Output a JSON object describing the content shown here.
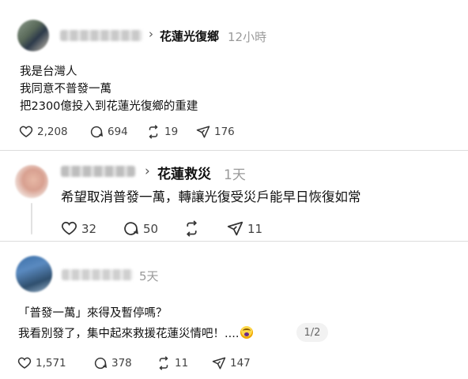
{
  "posts": [
    {
      "group": "花蓮光復鄉",
      "time": "12小時",
      "lines": [
        "我是台灣人",
        "我同意不普發一萬",
        "把2300億投入到花蓮光復鄉的重建"
      ],
      "likes": "2,208",
      "comments": "694",
      "reposts": "19",
      "shares": "176"
    },
    {
      "group": "花蓮救災",
      "time": "1天",
      "lines": [
        "希望取消普發一萬，轉讓光復受災戶能早日恢復如常"
      ],
      "likes": "32",
      "comments": "50",
      "reposts": "",
      "shares": "11"
    },
    {
      "group": "",
      "time": "5天",
      "lines": [
        "「普發一萬」來得及暫停嗎？",
        "我看別發了，集中起來救援花蓮災情吧！...."
      ],
      "page_indicator": "1/2",
      "likes": "1,571",
      "comments": "378",
      "reposts": "11",
      "shares": "147"
    }
  ],
  "icons": {
    "like": "heart-icon",
    "comment": "comment-bubble-icon",
    "repost": "repost-icon",
    "share": "send-icon",
    "chevron": "chevron-right-icon"
  }
}
